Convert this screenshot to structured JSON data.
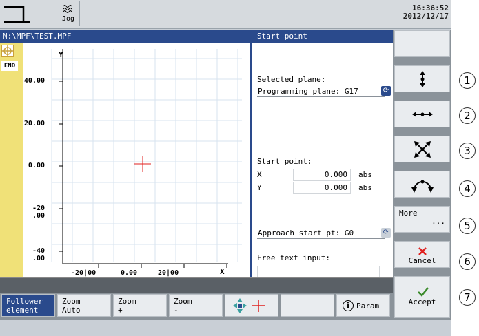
{
  "header": {
    "mode_label": "Jog",
    "time": "16:36:52",
    "date": "2012/12/17"
  },
  "path": "N:\\MPF\\TEST.MPF",
  "panel": {
    "title": "Start point",
    "selected_plane_label": "Selected plane:",
    "selected_plane_value": "Programming plane: G17",
    "start_point_label": "Start point:",
    "x_label": "X",
    "x_value": "0.000",
    "x_unit": "abs",
    "y_label": "Y",
    "y_value": "0.000",
    "y_unit": "abs",
    "approach_value": "Approach start pt: G0",
    "free_text_label": "Free text input:",
    "free_text_value": ""
  },
  "left_strip": {
    "end_label": "END"
  },
  "graph": {
    "y_axis_label": "Y",
    "x_axis_label": "X",
    "y_ticks": [
      "40.00",
      "20.00",
      "0.00",
      "-20\n.00",
      "-40\n.00"
    ],
    "x_ticks": [
      "-20|00",
      "0.00",
      "20|00"
    ]
  },
  "vertical_softkeys": {
    "more_label": "More",
    "more_dots": "...",
    "cancel_label": "Cancel",
    "accept_label": "Accept",
    "colors": {
      "cancel": "#e0201f",
      "accept": "#3a8a2a"
    }
  },
  "horizontal_softkeys": {
    "follower_line1": "Follower",
    "follower_line2": "element",
    "zoom_auto_line1": "Zoom",
    "zoom_auto_line2": "Auto",
    "zoom_in_line1": "Zoom",
    "zoom_in_line2": "+",
    "zoom_out_line1": "Zoom",
    "zoom_out_line2": "-",
    "param_label": "Param"
  },
  "callouts": [
    "1",
    "2",
    "3",
    "4",
    "5",
    "6",
    "7"
  ],
  "colors": {
    "title_bar": "#2a4a8c",
    "left_strip": "#f0e178",
    "marker": "#e0201f"
  }
}
